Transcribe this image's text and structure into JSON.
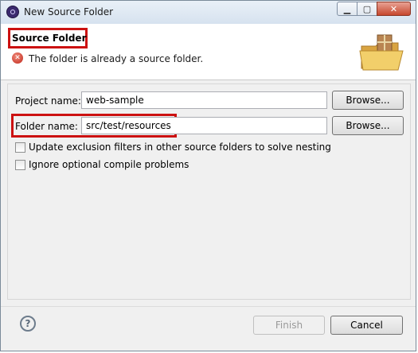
{
  "window": {
    "title": "New Source Folder",
    "controls": {
      "minimize_icon": "minimize-icon",
      "maximize_icon": "maximize-icon",
      "close_icon": "close-icon"
    }
  },
  "header": {
    "title": "Source Folder",
    "error_message": "The folder is already a source folder.",
    "error_icon": "error-icon",
    "banner_icon": "folder-package-icon"
  },
  "form": {
    "project_label": "Project name:",
    "project_value": "web-sample",
    "folder_label": "Folder name:",
    "folder_value": "src/test/resources",
    "browse_label": "Browse...",
    "options": [
      {
        "label": "Update exclusion filters in other source folders to solve nesting",
        "checked": false
      },
      {
        "label": "Ignore optional compile problems",
        "checked": false
      }
    ]
  },
  "footer": {
    "help_icon": "help-icon",
    "finish_label": "Finish",
    "finish_enabled": false,
    "cancel_label": "Cancel"
  },
  "colors": {
    "highlight": "#cc1111",
    "error": "#c0281c"
  }
}
